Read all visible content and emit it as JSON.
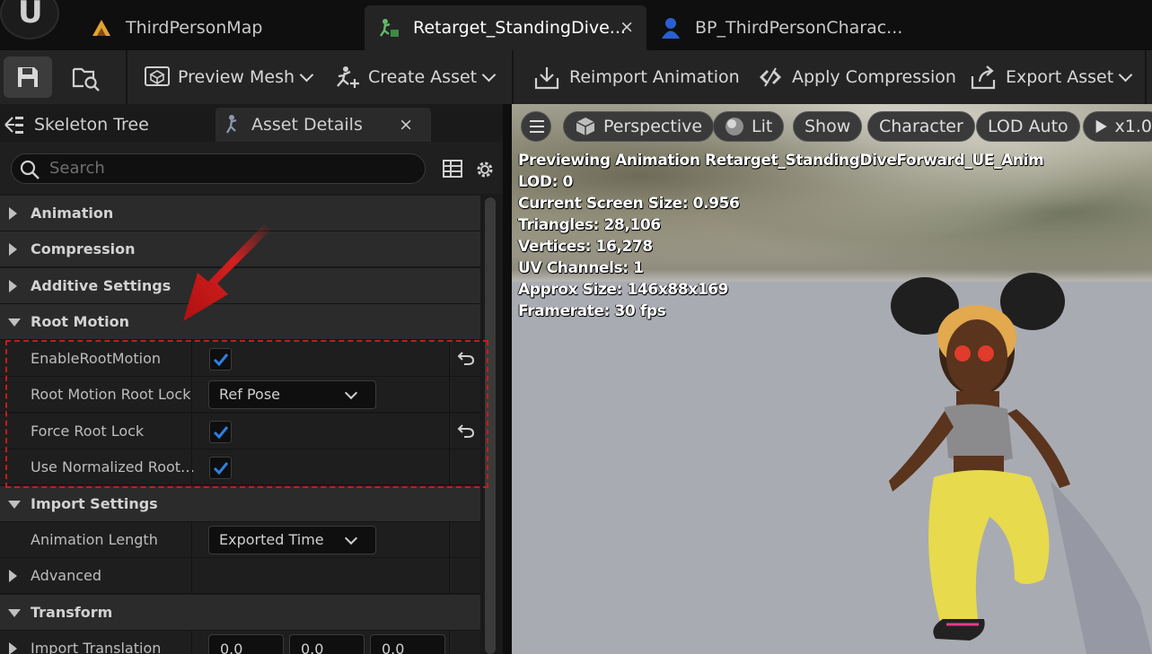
{
  "tabs": [
    {
      "label": "ThirdPersonMap",
      "icon": "level-icon"
    },
    {
      "label": "Retarget_StandingDive...",
      "icon": "animation-sequence-icon",
      "close": "×"
    },
    {
      "label": "BP_ThirdPersonCharac...",
      "icon": "blueprint-character-icon"
    }
  ],
  "toolbar": {
    "preview_mesh": "Preview Mesh",
    "create_asset": "Create Asset",
    "reimport_animation": "Reimport Animation",
    "apply_compression": "Apply Compression",
    "export_asset": "Export Asset"
  },
  "panel_tabs": {
    "skeleton_tree": "Skeleton Tree",
    "asset_details": "Asset Details",
    "close": "×"
  },
  "search": {
    "placeholder": "Search"
  },
  "details": {
    "animation": "Animation",
    "compression": "Compression",
    "additive_settings": "Additive Settings",
    "root_motion": "Root Motion",
    "enable_root_motion": {
      "label": "EnableRootMotion",
      "checked": true
    },
    "root_motion_root_lock": {
      "label": "Root Motion Root Lock",
      "value": "Ref Pose"
    },
    "force_root_lock": {
      "label": "Force Root Lock",
      "checked": true
    },
    "use_normalized_root": {
      "label": "Use Normalized Root…",
      "checked": true
    },
    "import_settings": "Import Settings",
    "animation_length": {
      "label": "Animation Length",
      "value": "Exported Time"
    },
    "advanced": "Advanced",
    "transform": "Transform",
    "import_translation": {
      "label": "Import Translation",
      "x": "0.0",
      "y": "0.0",
      "z": "0.0"
    }
  },
  "viewport": {
    "perspective": "Perspective",
    "lit": "Lit",
    "show": "Show",
    "character": "Character",
    "lod": "LOD Auto",
    "speed": "x1.0",
    "stats": [
      "Previewing Animation Retarget_StandingDiveForward_UE_Anim",
      "LOD: 0",
      "Current Screen Size: 0.956",
      "Triangles: 28,106",
      "Vertices: 16,278",
      "UV Channels: 1",
      "Approx Size: 146x88x169",
      "Framerate: 30 fps"
    ]
  },
  "colors": {
    "accent_blue": "#2f7fe0",
    "annotation_red": "#c91a1a",
    "panel_bg": "#1e1e1e",
    "category_bg": "#2b2b2b"
  }
}
